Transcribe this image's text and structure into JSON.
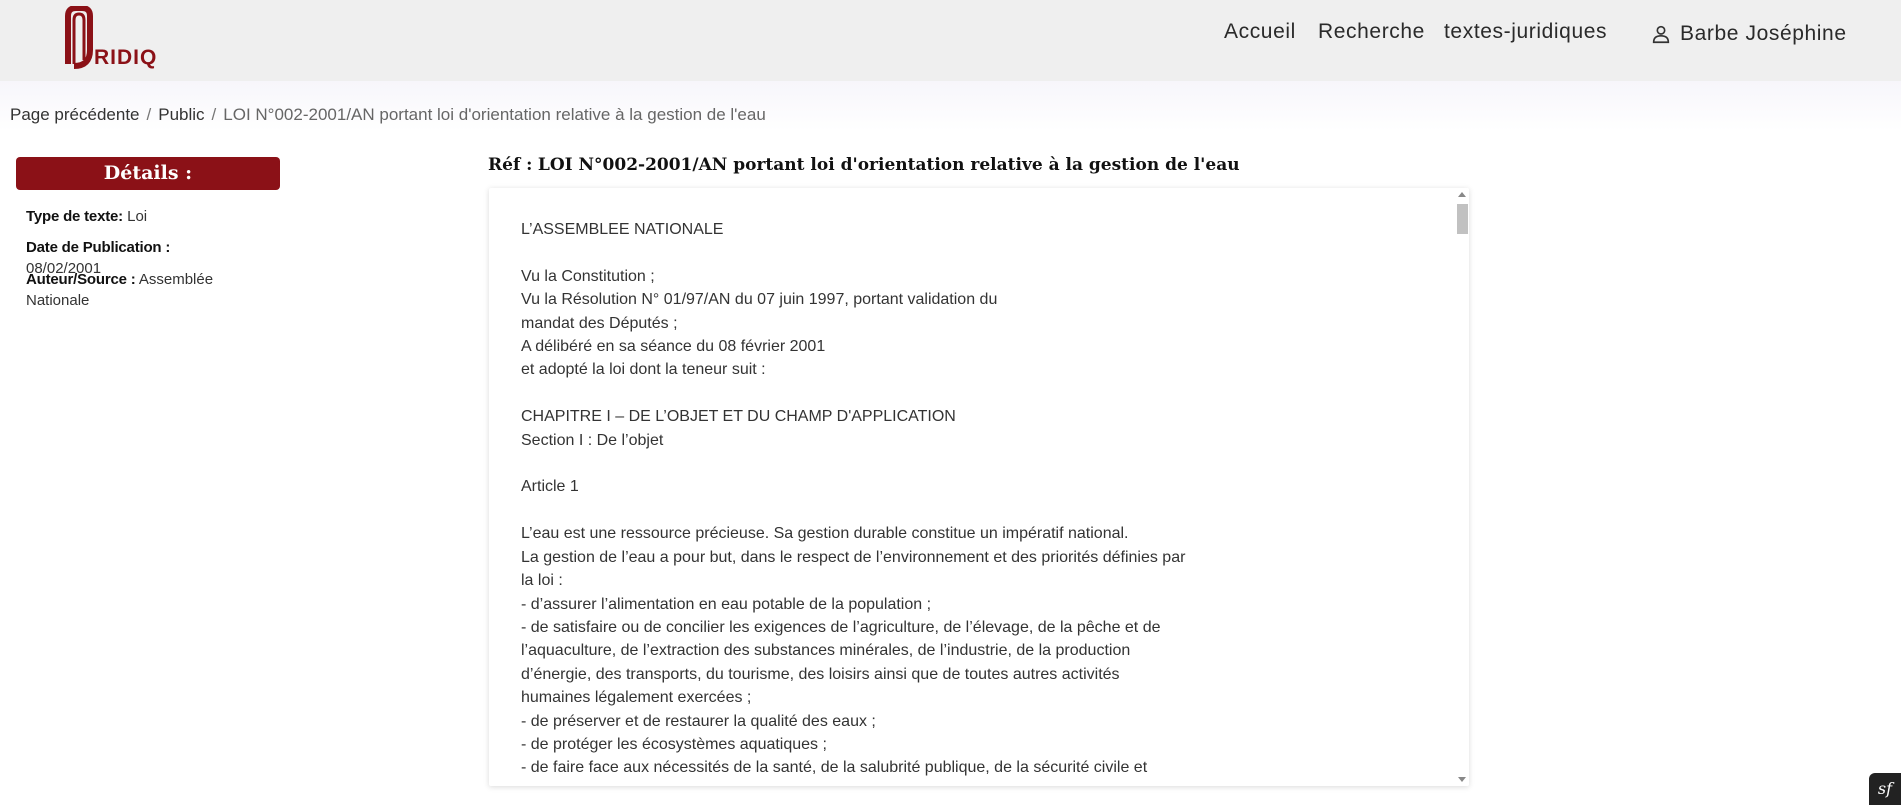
{
  "brand": {
    "logo_text": "RIDIQ",
    "accent_color": "#8b1117"
  },
  "nav": {
    "accueil": "Accueil",
    "recherche": "Recherche",
    "textes": "textes-juridiques",
    "user_name": "Barbe Joséphine",
    "user_icon": "person-icon"
  },
  "breadcrumb": {
    "previous": "Page précédente",
    "public": "Public",
    "current": "LOI N°002-2001/AN portant loi d'orientation relative à la gestion de l'eau"
  },
  "details": {
    "header": "Détails :",
    "type_label": "Type de texte:",
    "type_value": "Loi",
    "date_label": "Date de Publication :",
    "date_value": "08/02/2001",
    "author_label": "Auteur/Source :",
    "author_value": "Assemblée Nationale"
  },
  "document": {
    "ref_label": "Réf :",
    "ref_title": "LOI N°002-2001/AN portant loi d'orientation relative à la gestion de l'eau",
    "body": "L’ASSEMBLEE NATIONALE\n\nVu la Constitution ;\nVu la Résolution N° 01/97/AN du 07 juin 1997, portant validation du\nmandat des Députés ;\nA délibéré en sa séance du 08 février 2001\net adopté la loi dont la teneur suit :\n\nCHAPITRE I – DE L’OBJET ET DU CHAMP D'APPLICATION\nSection I : De l’objet\n\nArticle 1\n\nL’eau est une ressource précieuse. Sa gestion durable constitue un impératif national.\nLa gestion de l’eau a pour but, dans le respect de l’environnement et des priorités définies par\nla loi :\n- d’assurer l’alimentation en eau potable de la population ;\n- de satisfaire ou de concilier les exigences de l’agriculture, de l’élevage, de la pêche et de\nl’aquaculture, de l’extraction des substances minérales, de l’industrie, de la production\nd’énergie, des transports, du tourisme, des loisirs ainsi que de toutes autres activités\nhumaines légalement exercées ;\n- de préserver et de restaurer la qualité des eaux ;\n- de protéger les écosystèmes aquatiques ;\n- de faire face aux nécessités de la santé, de la salubrité publique, de la sécurité civile et"
  },
  "corner_badge_icon": "symfony-icon"
}
